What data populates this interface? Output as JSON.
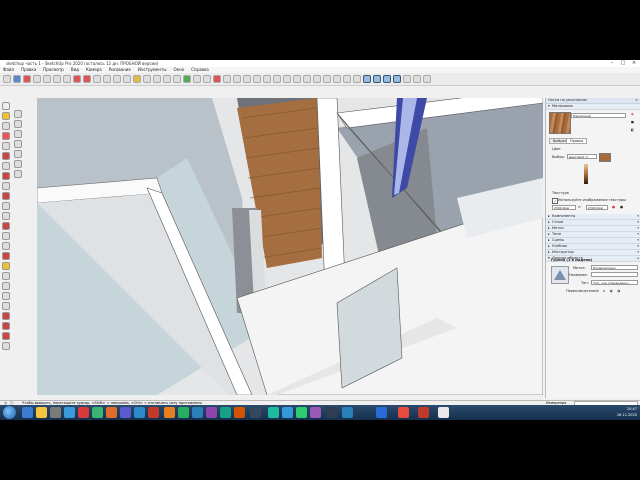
{
  "window": {
    "title": "sketchup часть 1 - SketchUp Pro 2020 (осталось 12 дн. ПРОБНОЙ версии)"
  },
  "menu": [
    "Файл",
    "Правка",
    "Просмотр",
    "Вид",
    "Камера",
    "Рисование",
    "Инструменты",
    "Окно",
    "Справка"
  ],
  "panel": {
    "title": "Лотки по умолчанию",
    "materials_header": "Материалы",
    "material_name": "Паркетный",
    "tabs": {
      "select": "Выбрать",
      "edit": "Правка"
    },
    "color_label": "Цвет",
    "picker_label": "Выбор:",
    "picker_value": "Цветовой ст",
    "texture_header": "Текстура",
    "use_texture_label": "Используйте изображение текстуры",
    "texture_size": "2300.0мм",
    "collapsed_sections": [
      "Компоненты",
      "Стили",
      "Метки",
      "Тени",
      "Сцены",
      "Учебник",
      "Инструктор",
      "Данные объекта"
    ],
    "entity_header": "Группа (1 в модели)",
    "entity": {
      "layer_label": "Метка:",
      "layer_value": "Незакреплено",
      "name_label": "Название:",
      "name_value": "",
      "type_label": "Тип:",
      "type_value": "Тип: <не определено>",
      "toggles_label": "Переключатели:"
    }
  },
  "status": {
    "hint": "Чтобы вращать, перетащите курсор. <Shift> = панорама, <Ctrl> = отключить силу притяжения",
    "measurements_label": "Измерения"
  },
  "taskbar": {
    "time": "20:47",
    "date": "26.11.2020"
  }
}
